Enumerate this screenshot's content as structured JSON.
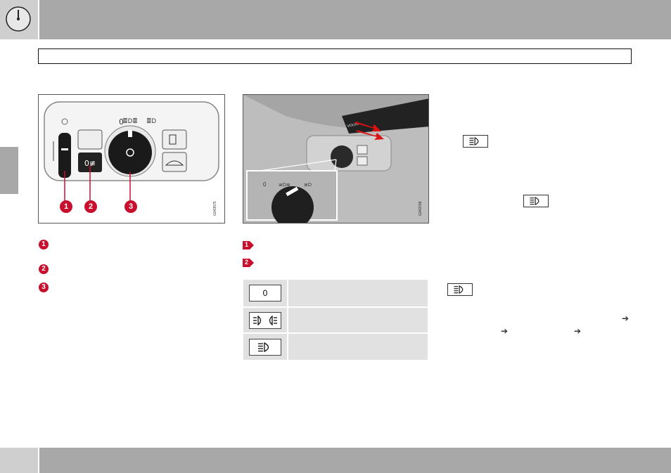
{
  "header": {
    "icon": "speedometer-icon",
    "title": ""
  },
  "figure_left": {
    "callouts": [
      "1",
      "2",
      "3"
    ],
    "code": "G043575",
    "panel_label_zero": "0"
  },
  "figure_right": {
    "code": "G043766",
    "inset_label_zero": "0",
    "stalk_label": "VOLVO"
  },
  "legend_left": {
    "items": [
      {
        "marker": "1"
      },
      {
        "marker": "2"
      },
      {
        "marker": "3"
      }
    ]
  },
  "legend_right": {
    "items": [
      {
        "marker": "1"
      },
      {
        "marker": "2"
      }
    ]
  },
  "light_table": {
    "rows": [
      {
        "symbol": "0",
        "icon": "zero-symbol"
      },
      {
        "symbol": "",
        "icon": "parking-lights-icon"
      },
      {
        "symbol": "",
        "icon": "high-beam-icon"
      }
    ]
  },
  "colors": {
    "accent": "#c8102e",
    "bar": "#a8a8a8",
    "table": "#e1e1e1"
  }
}
